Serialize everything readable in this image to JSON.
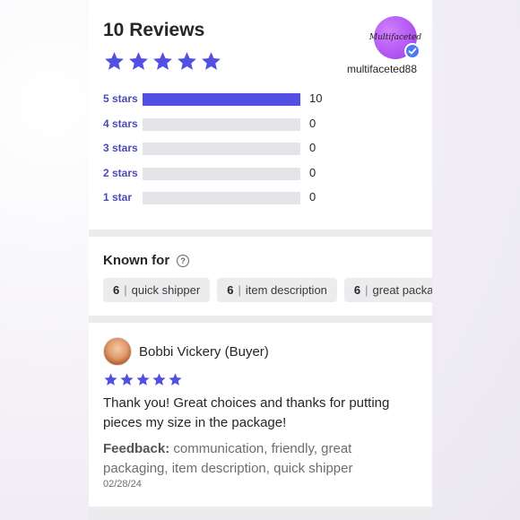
{
  "summary": {
    "title": "10 Reviews",
    "rating_stars": 5,
    "seller": {
      "username": "multifaceted88",
      "avatar_text": "Multifaceted",
      "verified": true
    },
    "breakdown": [
      {
        "label": "5 stars",
        "count": "10",
        "fraction": 1.0
      },
      {
        "label": "4 stars",
        "count": "0",
        "fraction": 0
      },
      {
        "label": "3 stars",
        "count": "0",
        "fraction": 0
      },
      {
        "label": "2 stars",
        "count": "0",
        "fraction": 0
      },
      {
        "label": "1 star",
        "count": "0",
        "fraction": 0
      }
    ]
  },
  "known_for": {
    "title": "Known for",
    "tags": [
      {
        "count": "6",
        "label": "quick shipper"
      },
      {
        "count": "6",
        "label": "item description"
      },
      {
        "count": "6",
        "label": "great packaging"
      }
    ]
  },
  "review": {
    "reviewer": "Bobbi Vickery (Buyer)",
    "stars": 5,
    "text": "Thank you! Great choices and thanks for putting pieces my size in the package!",
    "feedback_label": "Feedback:",
    "feedback_text": "communication, friendly, great packaging, item description, quick shipper",
    "date": "02/28/24"
  },
  "colors": {
    "accent": "#5150e2",
    "bar_track": "#e5e5e9",
    "verified": "#4b7bf2"
  }
}
